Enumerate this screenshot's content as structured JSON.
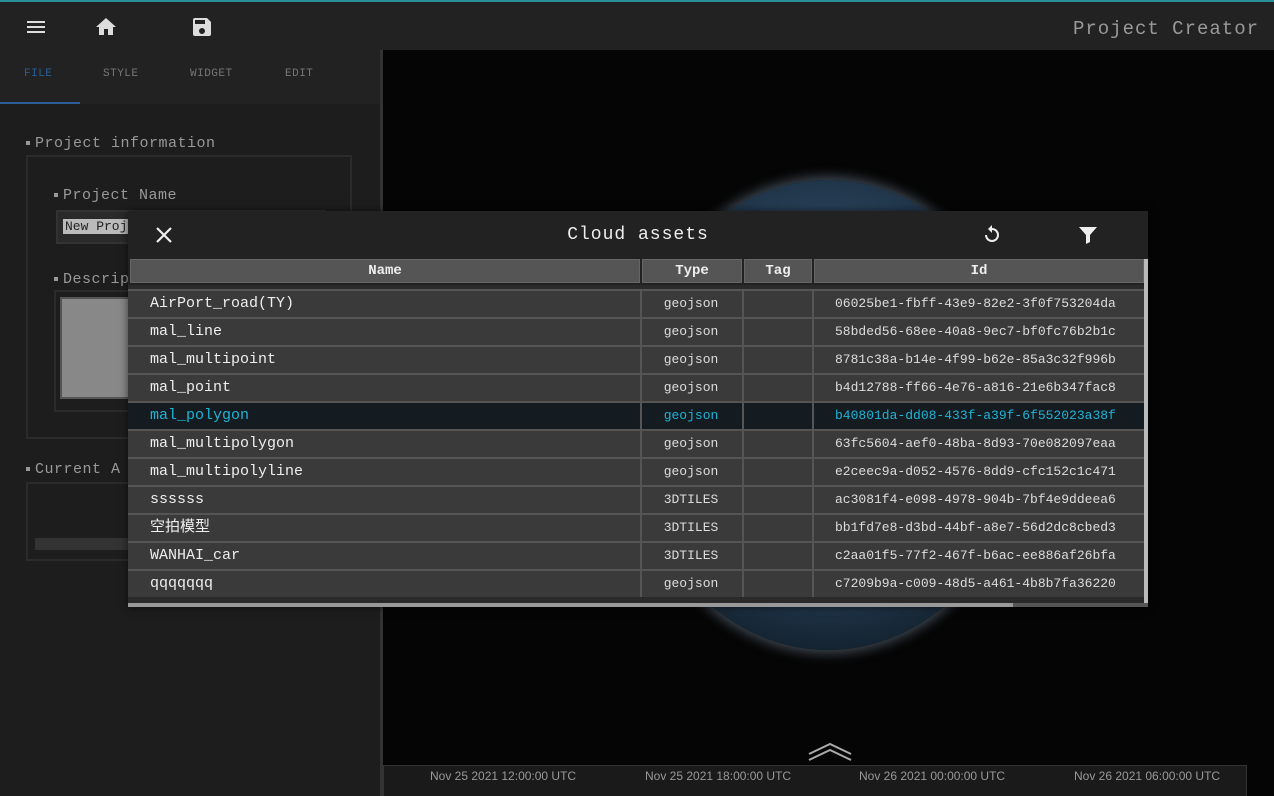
{
  "app": {
    "title": "Project Creator"
  },
  "tabs": [
    "FILE",
    "STYLE",
    "WIDGET",
    "EDIT"
  ],
  "left": {
    "project_information": "Project information",
    "project_name_label": "Project Name",
    "project_name_value": "New Proj",
    "description_label": "Descrip",
    "current_label": "Current A"
  },
  "timeline": {
    "labels": [
      "Nov 25 2021 12:00:00 UTC",
      "Nov 25 2021 18:00:00 UTC",
      "Nov 26 2021 00:00:00 UTC",
      "Nov 26 2021 06:00:00 UTC"
    ]
  },
  "dialog": {
    "title": "Cloud assets",
    "columns": {
      "name": "Name",
      "type": "Type",
      "tag": "Tag",
      "id": "Id"
    },
    "rows": [
      {
        "name": "AirPort_road(TY)",
        "type": "geojson",
        "tag": "",
        "id": "06025be1-fbff-43e9-82e2-3f0f753204da",
        "selected": false
      },
      {
        "name": "mal_line",
        "type": "geojson",
        "tag": "",
        "id": "58bded56-68ee-40a8-9ec7-bf0fc76b2b1c",
        "selected": false
      },
      {
        "name": "mal_multipoint",
        "type": "geojson",
        "tag": "",
        "id": "8781c38a-b14e-4f99-b62e-85a3c32f996b",
        "selected": false
      },
      {
        "name": "mal_point",
        "type": "geojson",
        "tag": "",
        "id": "b4d12788-ff66-4e76-a816-21e6b347fac8",
        "selected": false
      },
      {
        "name": "mal_polygon",
        "type": "geojson",
        "tag": "",
        "id": "b40801da-dd08-433f-a39f-6f552023a38f",
        "selected": true
      },
      {
        "name": "mal_multipolygon",
        "type": "geojson",
        "tag": "",
        "id": "63fc5604-aef0-48ba-8d93-70e082097eaa",
        "selected": false
      },
      {
        "name": "mal_multipolyline",
        "type": "geojson",
        "tag": "",
        "id": "e2ceec9a-d052-4576-8dd9-cfc152c1c471",
        "selected": false
      },
      {
        "name": "ssssss",
        "type": "3DTILES",
        "tag": "",
        "id": "ac3081f4-e098-4978-904b-7bf4e9ddeea6",
        "selected": false
      },
      {
        "name": "空拍模型",
        "type": "3DTILES",
        "tag": "",
        "id": "bb1fd7e8-d3bd-44bf-a8e7-56d2dc8cbed3",
        "selected": false
      },
      {
        "name": "WANHAI_car",
        "type": "3DTILES",
        "tag": "",
        "id": "c2aa01f5-77f2-467f-b6ac-ee886af26bfa",
        "selected": false
      },
      {
        "name": "qqqqqqq",
        "type": "geojson",
        "tag": "",
        "id": "c7209b9a-c009-48d5-a461-4b8b7fa36220",
        "selected": false
      }
    ]
  },
  "icons": {
    "menu": "menu-icon",
    "home": "home-icon",
    "save": "save-icon",
    "close": "close-icon",
    "refresh": "refresh-icon",
    "filter": "filter-icon",
    "expand": "chevron-up-icon"
  }
}
